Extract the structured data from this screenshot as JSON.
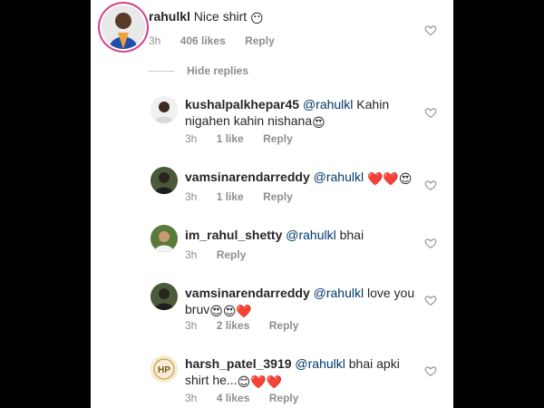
{
  "comments": [
    {
      "user": "rahulkl",
      "mention": "",
      "text": "Nice shirt",
      "emoji": "😶",
      "time": "3h",
      "likes": "406 likes",
      "reply": "Reply"
    },
    {
      "user": "kushalpalkhepar45",
      "mention": "@rahulkl",
      "text": "Kahin nigahen kahin nishana",
      "emoji": "😍",
      "time": "3h",
      "likes": "1 like",
      "reply": "Reply"
    },
    {
      "user": "vamsinarendarreddy",
      "mention": "@rahulkl",
      "text": "",
      "emoji": "❤️❤️😍",
      "time": "3h",
      "likes": "1 like",
      "reply": "Reply"
    },
    {
      "user": "im_rahul_shetty",
      "mention": "@rahulkl",
      "text": "bhai",
      "emoji": "",
      "time": "3h",
      "likes": "",
      "reply": "Reply"
    },
    {
      "user": "vamsinarendarreddy",
      "mention": "@rahulkl",
      "text": "love you bruv",
      "emoji": "😍😍❤️",
      "time": "3h",
      "likes": "2 likes",
      "reply": "Reply"
    },
    {
      "user": "harsh_patel_3919",
      "mention": "@rahulkl",
      "text": "bhai apki shirt he...",
      "emoji": "😊❤️❤️",
      "time": "3h",
      "likes": "4 likes",
      "reply": "Reply"
    }
  ],
  "hide_replies": "Hide replies",
  "avatar_badges": {
    "harsh": "HP"
  },
  "colors": {
    "mention": "#00376b",
    "meta": "#8e8e8e",
    "text": "#262626"
  }
}
